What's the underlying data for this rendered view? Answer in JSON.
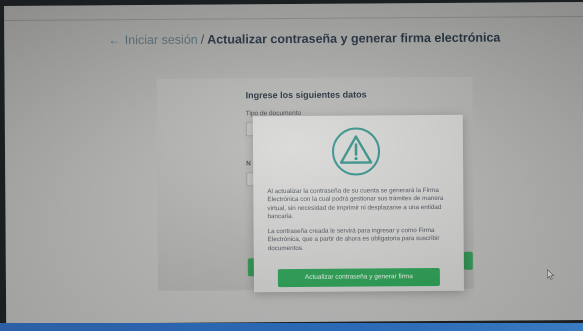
{
  "header": {
    "back_arrow": "←",
    "back_link": "Iniciar sesión",
    "separator": "/",
    "current_page": "Actualizar contraseña y generar firma electrónica"
  },
  "form": {
    "heading": "Ingrese los siguientes datos",
    "document_type_label": "Tipo de documento",
    "second_label": "N"
  },
  "modal": {
    "icon": "warning-triangle-icon",
    "paragraph_1": "Al actualizar la contraseña de su cuenta se generará la Firma Electrónica con la cual podrá gestionar sus trámites de manera virtual, sin necesidad de imprimir ni desplazarse a una entidad bancaria.",
    "paragraph_2": "La contraseña creada le servirá para ingresar y como Firma Electrónica, que a partir de ahora es obligatoria para suscribir documentos.",
    "button_label": "Actualizar contraseña y generar firma"
  },
  "colors": {
    "accent_green": "#28a454",
    "warning_teal": "#2f8f87"
  }
}
